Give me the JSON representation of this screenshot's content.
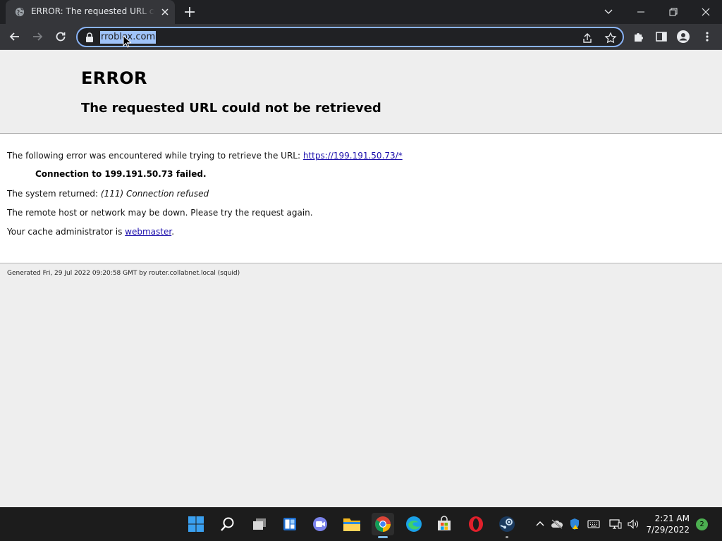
{
  "tab": {
    "title": "ERROR: The requested URL could not be retrieved"
  },
  "omnibox": {
    "url": "rroblox.com"
  },
  "page": {
    "heading": "ERROR",
    "subheading": "The requested URL could not be retrieved",
    "intro_text": "The following error was encountered while trying to retrieve the URL: ",
    "intro_link": "https://199.191.50.73/*",
    "failed": "Connection to 199.191.50.73 failed.",
    "returned_prefix": "The system returned: ",
    "returned_value": "(111) Connection refused",
    "remote_down": "The remote host or network may be down. Please try the request again.",
    "cache_prefix": "Your cache administrator is ",
    "cache_link": "webmaster",
    "cache_suffix": ".",
    "generated": "Generated Fri, 29 Jul 2022 09:20:58 GMT by router.collabnet.local (squid)"
  },
  "taskbar": {
    "apps": [
      "start-icon",
      "search-icon",
      "task-view-icon",
      "widgets-icon",
      "teams-chat-icon",
      "file-explorer-icon",
      "chrome-icon",
      "edge-icon",
      "microsoft-store-icon",
      "opera-icon",
      "steam-icon"
    ],
    "time": "2:21 AM",
    "date": "7/29/2022",
    "notification_count": "2"
  },
  "colors": {
    "accent": "#8ab4f8",
    "link": "#1a0dab",
    "chrome_dark": "#202124",
    "chrome_tab": "#35363a"
  }
}
